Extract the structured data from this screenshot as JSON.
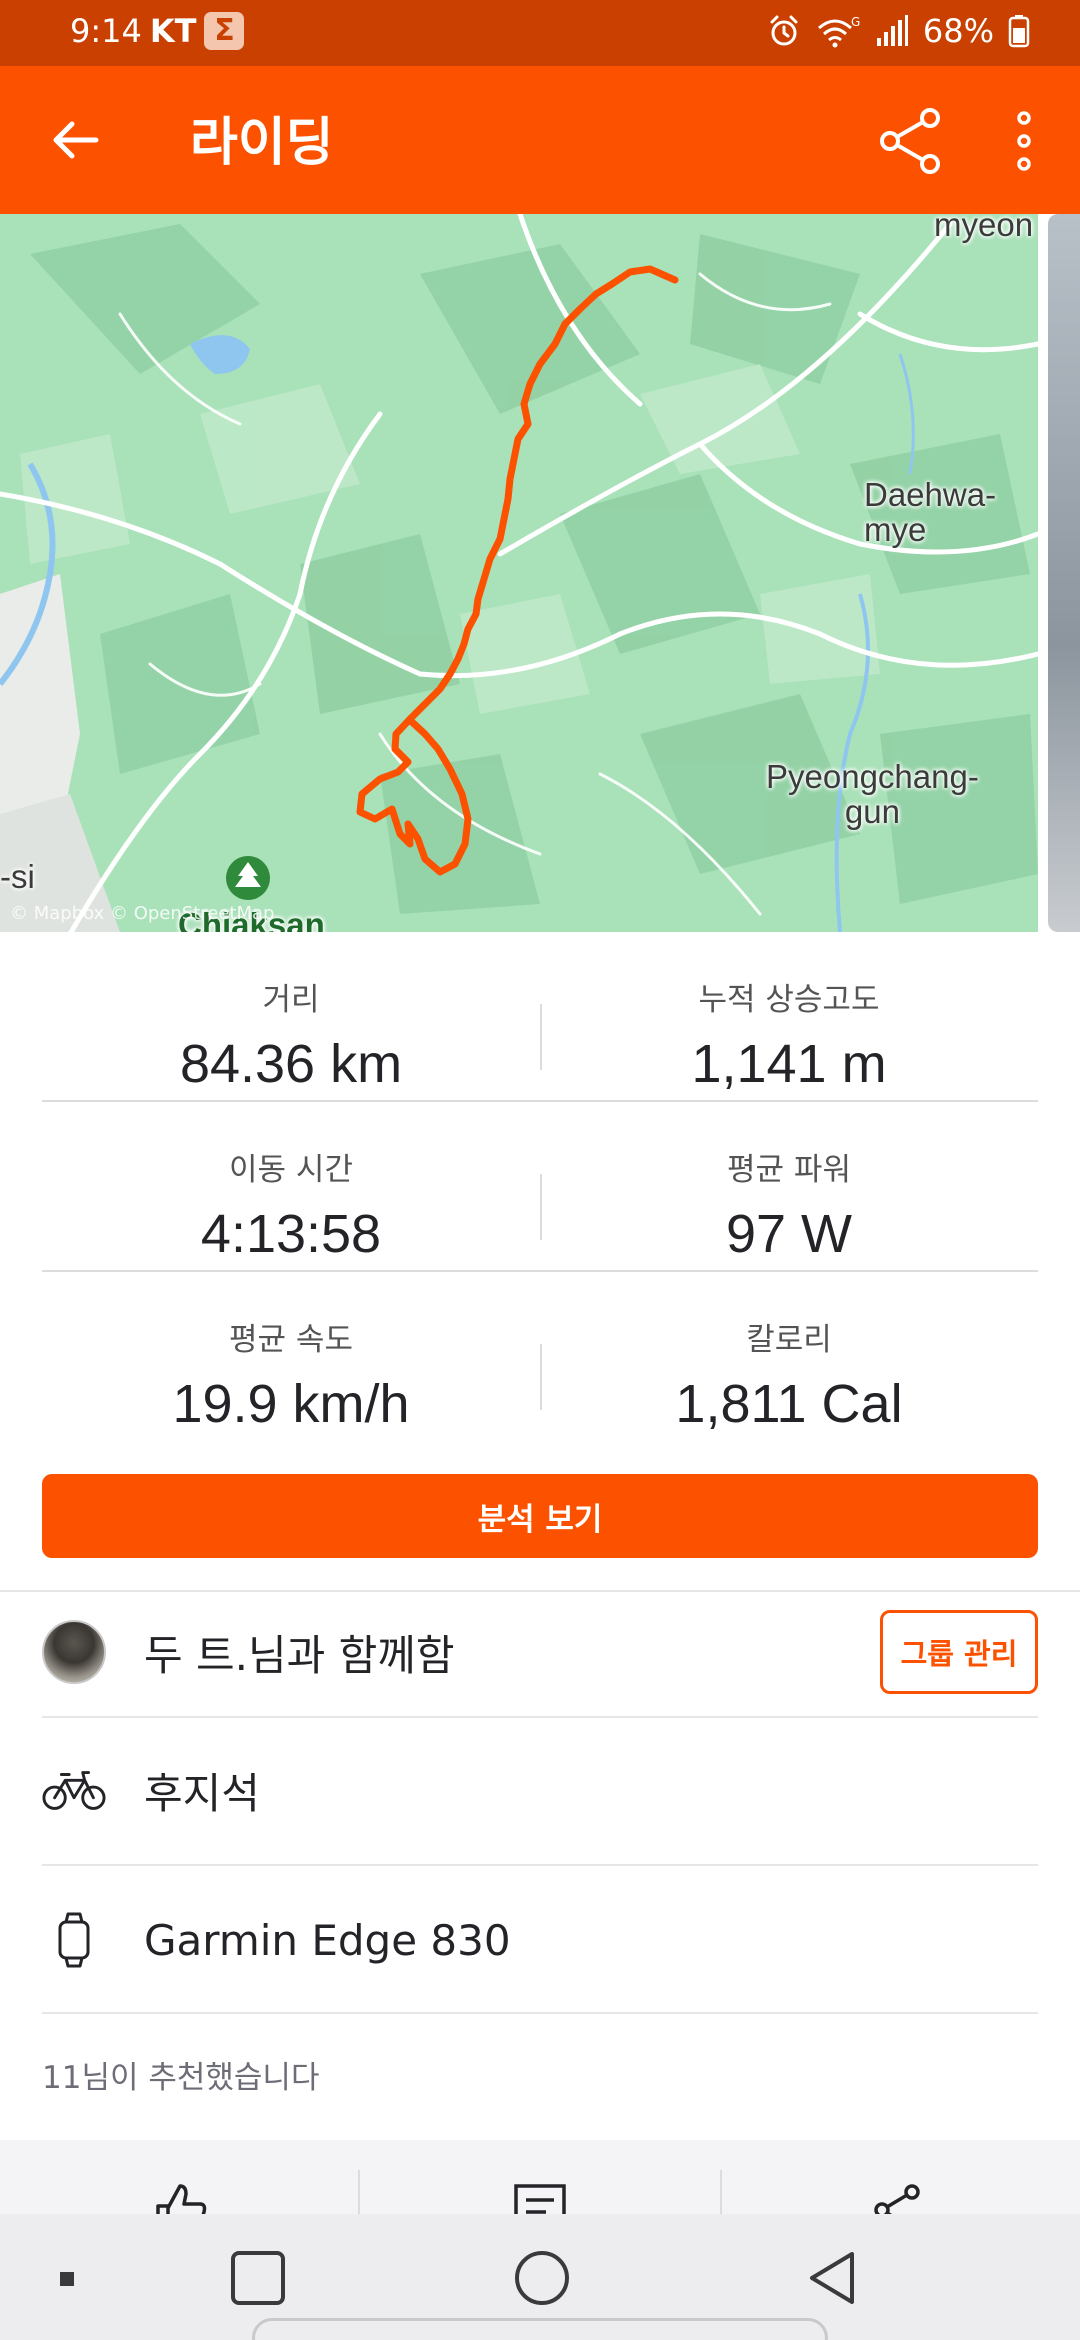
{
  "status_bar": {
    "time": "9:14",
    "carrier": "KT",
    "battery": "68%",
    "icons": [
      "alarm-icon",
      "wifi-5g-icon",
      "signal-icon",
      "battery-icon"
    ]
  },
  "app_bar": {
    "title": "라이딩",
    "icons": [
      "back-arrow-icon",
      "share-icon",
      "more-vert-icon"
    ],
    "background_color": "#fc5200"
  },
  "map": {
    "labels": [
      "myeon",
      "Daehwa-mye",
      "Pyeongchang-\ngun",
      "Chiaksan",
      "-si"
    ],
    "attribution": "© Mapbox © OpenStreetMap",
    "route_color": "#fc5200"
  },
  "stats": [
    {
      "label": "거리",
      "value": "84.36 km"
    },
    {
      "label": "누적 상승고도",
      "value": "1,141 m"
    },
    {
      "label": "이동 시간",
      "value": "4:13:58"
    },
    {
      "label": "평균 파워",
      "value": "97 W"
    },
    {
      "label": "평균 속도",
      "value": "19.9 km/h"
    },
    {
      "label": "칼로리",
      "value": "1,811 Cal"
    }
  ],
  "analysis_button": "분석 보기",
  "group": {
    "text": "두 트.님과 함께함",
    "button": "그룹 관리"
  },
  "bike": {
    "icon": "bicycle-icon",
    "name": "후지석"
  },
  "device": {
    "icon": "watch-icon",
    "name": "Garmin Edge 830"
  },
  "kudos_text": "11님이 추천했습니다",
  "actions": [
    "thumbs-up-icon",
    "comment-icon",
    "share-icon"
  ],
  "nav": [
    "recents-icon",
    "home-icon",
    "back-icon"
  ]
}
